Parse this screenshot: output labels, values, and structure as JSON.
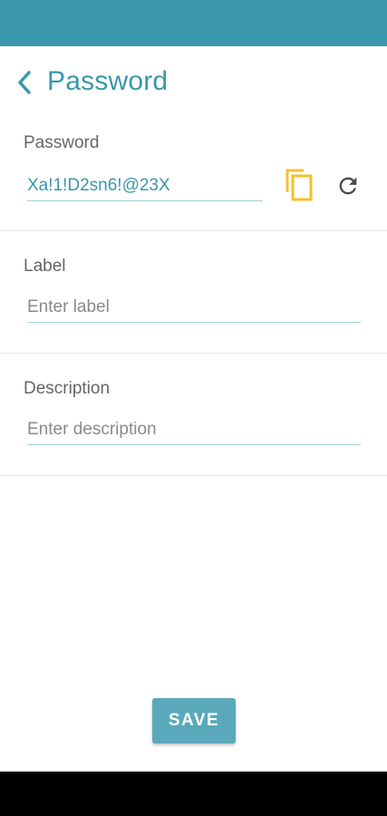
{
  "header": {
    "title": "Password"
  },
  "password_section": {
    "label": "Password",
    "value": "Xa!1!D2sn6!@23X"
  },
  "label_section": {
    "label": "Label",
    "placeholder": "Enter label"
  },
  "description_section": {
    "label": "Description",
    "placeholder": "Enter description"
  },
  "actions": {
    "save_label": "SAVE"
  },
  "colors": {
    "primary": "#3a97ab",
    "copy_icon": "#f5c02e",
    "save_button": "#5aa9bb"
  },
  "icons": [
    "back-icon",
    "copy-icon",
    "refresh-icon"
  ]
}
